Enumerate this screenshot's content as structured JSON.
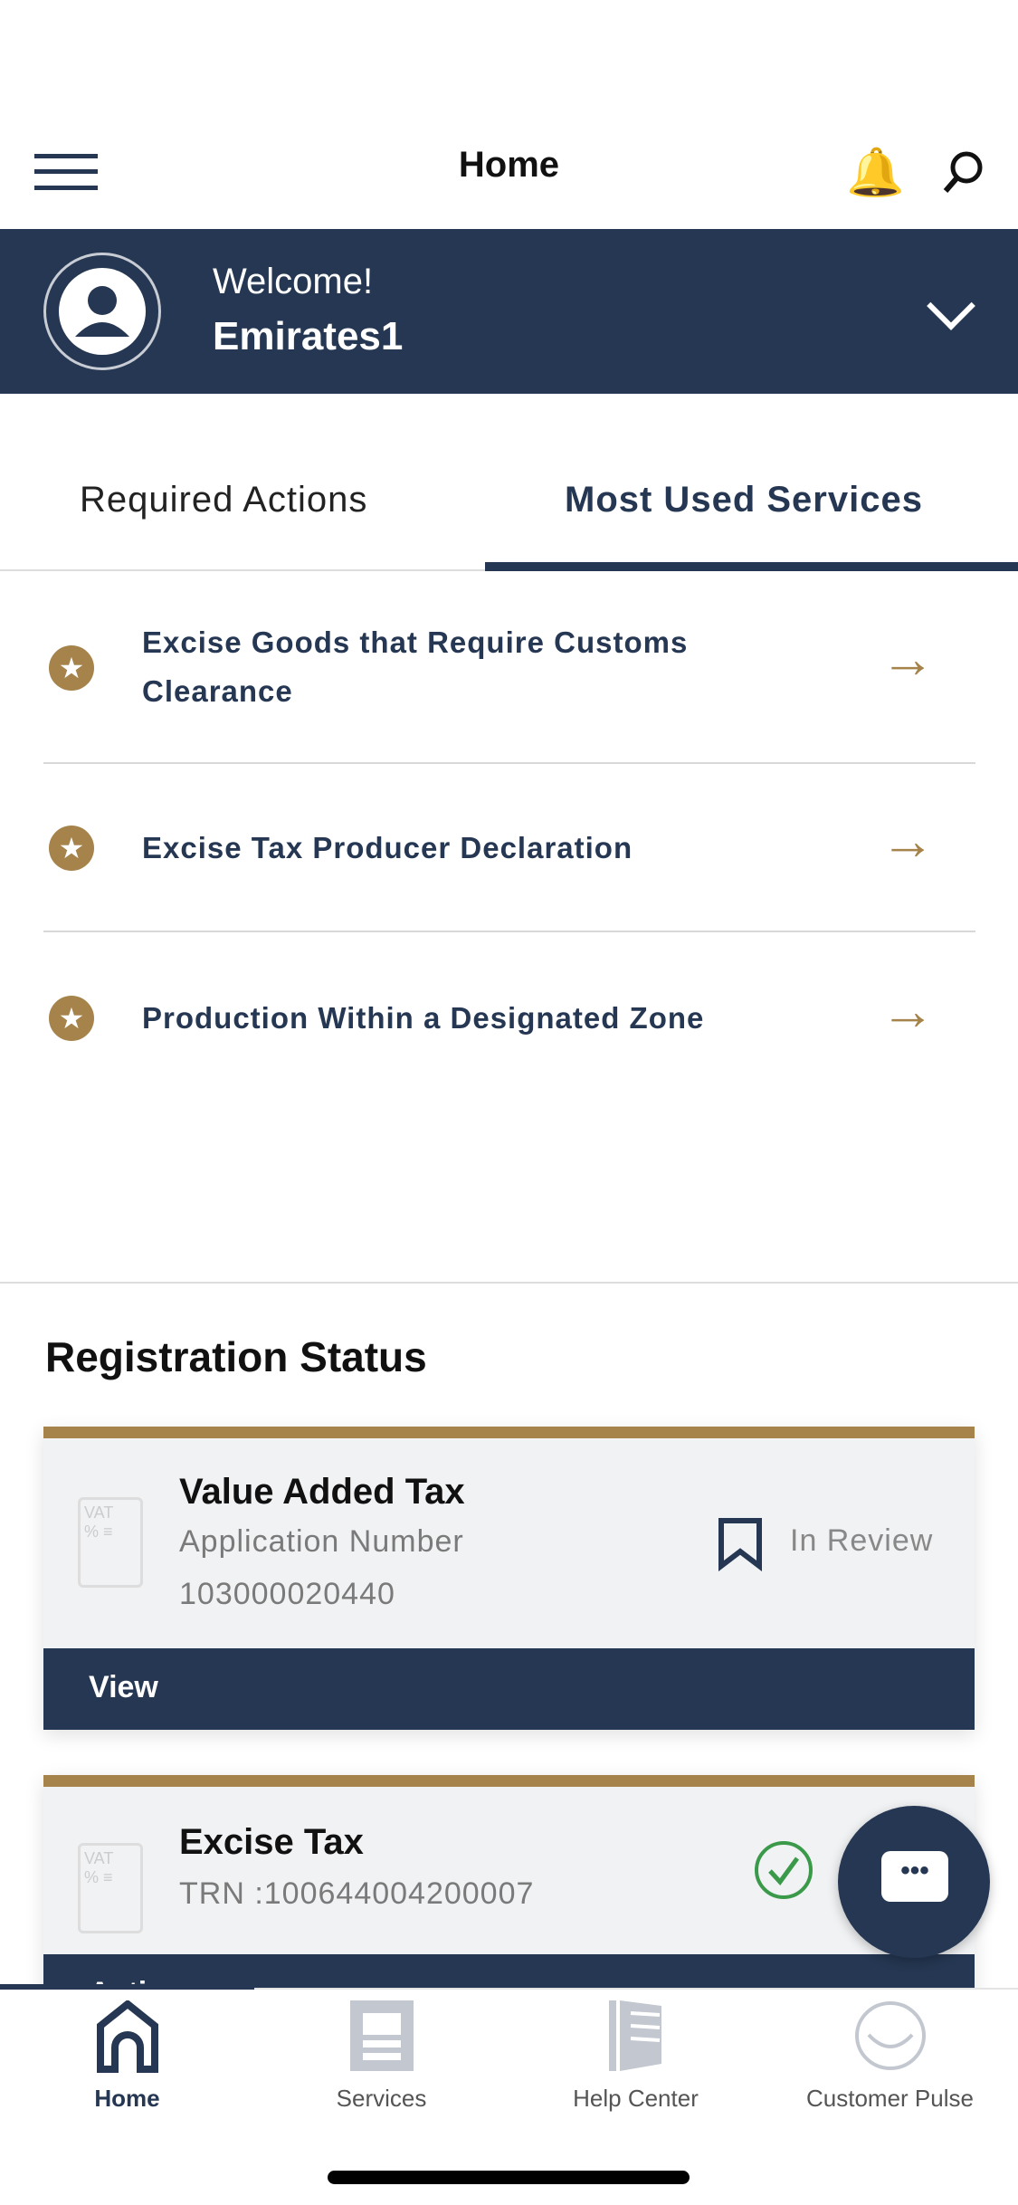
{
  "header": {
    "title": "Home",
    "menu_icon": "hamburger-icon",
    "bell_icon": "bell-icon",
    "search_icon": "search-icon"
  },
  "welcome": {
    "greeting": "Welcome!",
    "username": "Emirates1"
  },
  "tabs": [
    {
      "label": "Required Actions",
      "active": false
    },
    {
      "label": "Most Used Services",
      "active": true
    }
  ],
  "services": [
    {
      "label": "Excise Goods that Require Customs Clearance"
    },
    {
      "label": "Excise Tax Producer Declaration"
    },
    {
      "label": "Production Within a Designated Zone"
    }
  ],
  "registration": {
    "title": "Registration Status",
    "cards": [
      {
        "title": "Value Added Tax",
        "subtitle": "Application Number",
        "number": "103000020440",
        "status": "In Review",
        "button": "View"
      },
      {
        "title": "Excise Tax",
        "subtitle": "TRN :100644004200007",
        "status": "approved",
        "button": "Action"
      }
    ]
  },
  "bottom_nav": [
    {
      "label": "Home",
      "active": true
    },
    {
      "label": "Services"
    },
    {
      "label": "Help Center"
    },
    {
      "label": "Customer Pulse"
    }
  ],
  "colors": {
    "navy": "#253752",
    "gold": "#a5834a",
    "green": "#3a9a4a"
  }
}
